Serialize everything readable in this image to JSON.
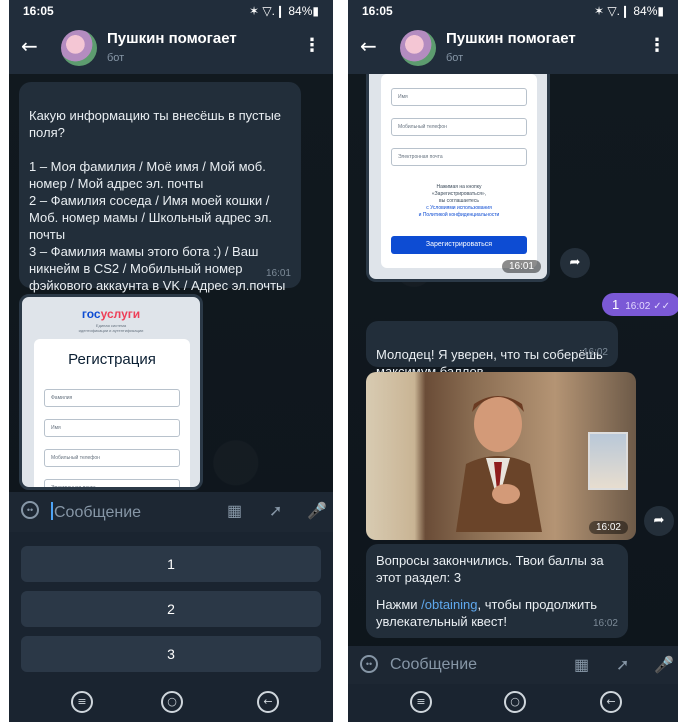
{
  "left": {
    "status": {
      "time": "16:05",
      "indicators": "✶ ▽.❙ 84%▮"
    },
    "header": {
      "title": "Пушкин помогает",
      "subtitle": "бот"
    },
    "question_bubble": {
      "text": "Какую информацию ты внесёшь в пустые поля?\n\n1 – Моя фамилия / Моё имя / Мой моб. номер / Мой адрес эл. почты\n2 – Фамилия соседа / Имя моей кошки / Моб. номер мамы / Школьный адрес эл. почты\n3 – Фамилия мамы этого бота :) / Ваш никнейм в CS2 / Мобильный номер фэйкового аккаунта в VK / Адрес эл.почты из Sims",
      "time": "16:01"
    },
    "gosuslugi_card": {
      "logo_a": "гос",
      "logo_b": "услуги",
      "logo_sub": "Единая система\nидентификации и аутентификации",
      "form_title": "Регистрация",
      "fields": [
        "Фамилия",
        "Имя",
        "Мобильный телефон",
        "Электронная почта"
      ]
    },
    "input": {
      "placeholder": "Сообщение"
    },
    "keyboard": [
      "1",
      "2",
      "3"
    ]
  },
  "right": {
    "status": {
      "time": "16:05",
      "indicators": "✶ ▽.❙ 84%▮"
    },
    "header": {
      "title": "Пушкин помогает",
      "subtitle": "бот"
    },
    "gosuslugi_card": {
      "fields": [
        "Имя",
        "Мобильный телефон",
        "Электронная почта"
      ],
      "legal_1": "Нажимая на кнопку",
      "legal_2": "«Зарегистрироваться»,",
      "legal_3": "вы соглашаетесь",
      "legal_link_1": "с Условиями использования",
      "legal_link_2": "и Политикой конфиденциальности",
      "register_button": "Зарегистрироваться",
      "time": "16:01"
    },
    "outgoing": {
      "text": "1",
      "time": "16:02"
    },
    "praise_bubble": {
      "text": "Молодец! Я уверен, что ты соберёшь максимум баллов.",
      "time": "16:02"
    },
    "photo": {
      "time": "16:02"
    },
    "final_bubble": {
      "text_1": "Вопросы закончились. Твои баллы за этот раздел: 3",
      "text_2_pre": "Нажми ",
      "text_2_link": "/obtaining",
      "text_2_post": ", чтобы продолжить увлекательный квест!",
      "time": "16:02"
    },
    "input": {
      "placeholder": "Сообщение"
    }
  }
}
